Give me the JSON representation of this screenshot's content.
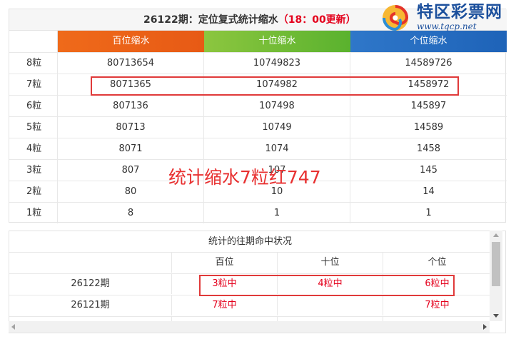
{
  "top": {
    "title_main": "26122期：定位复式统计缩水",
    "title_red": "（18：00更新）",
    "headers": [
      "百位缩水",
      "十位缩水",
      "个位缩水"
    ],
    "rows": [
      {
        "label": "8粒",
        "v": [
          "80713654",
          "10749823",
          "14589726"
        ]
      },
      {
        "label": "7粒",
        "v": [
          "8071365",
          "1074982",
          "1458972"
        ]
      },
      {
        "label": "6粒",
        "v": [
          "807136",
          "107498",
          "145897"
        ]
      },
      {
        "label": "5粒",
        "v": [
          "80713",
          "10749",
          "14589"
        ]
      },
      {
        "label": "4粒",
        "v": [
          "8071",
          "1074",
          "1458"
        ]
      },
      {
        "label": "3粒",
        "v": [
          "807",
          "107",
          "145"
        ]
      },
      {
        "label": "2粒",
        "v": [
          "80",
          "10",
          "14"
        ]
      },
      {
        "label": "1粒",
        "v": [
          "8",
          "1",
          "1"
        ]
      }
    ]
  },
  "logo": {
    "brand": "特区彩票网",
    "url": "www.tqcp.net"
  },
  "overlay_note": "统计缩水7粒红747",
  "hits": {
    "title": "统计的往期命中状况",
    "headers": [
      "",
      "百位",
      "十位",
      "个位"
    ],
    "rows": [
      {
        "period": "26122期",
        "v": [
          "3粒中",
          "4粒中",
          "6粒中"
        ]
      },
      {
        "period": "26121期",
        "v": [
          "7粒中",
          "",
          "7粒中"
        ]
      }
    ]
  },
  "colors": {
    "hundreds": "#ef6a1a",
    "tens": "#5ab22e",
    "units": "#1e63b8",
    "hit_red": "#e4001c",
    "annotation_red": "#e03a3a"
  }
}
